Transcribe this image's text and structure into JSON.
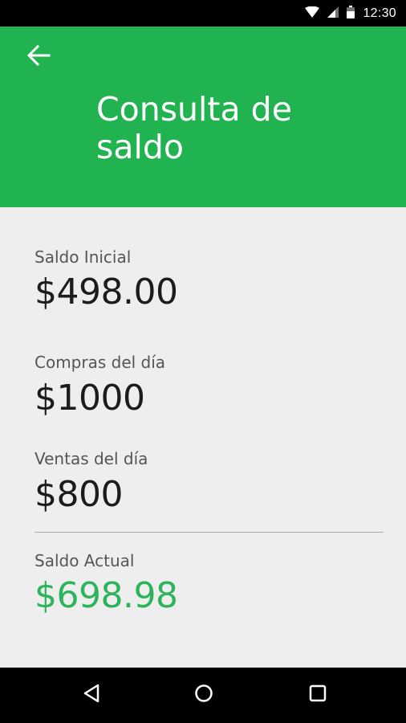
{
  "status_bar": {
    "time": "12:30",
    "icons": [
      "wifi-icon",
      "signal-icon",
      "battery-icon"
    ]
  },
  "app_bar": {
    "title": "Consulta de saldo",
    "back_icon": "arrow-left-icon",
    "background_color": "#22b351"
  },
  "balance": {
    "initial": {
      "label": "Saldo Inicial",
      "value": "$498.00"
    },
    "purchases": {
      "label": "Compras del día",
      "value": "$1000"
    },
    "sales": {
      "label": "Ventas del día",
      "value": "$800"
    },
    "current": {
      "label": "Saldo Actual",
      "value": "$698.98",
      "color": "#2bb45b"
    }
  },
  "nav_bar": {
    "icons": [
      "back-triangle-icon",
      "home-circle-icon",
      "recents-square-icon"
    ]
  }
}
